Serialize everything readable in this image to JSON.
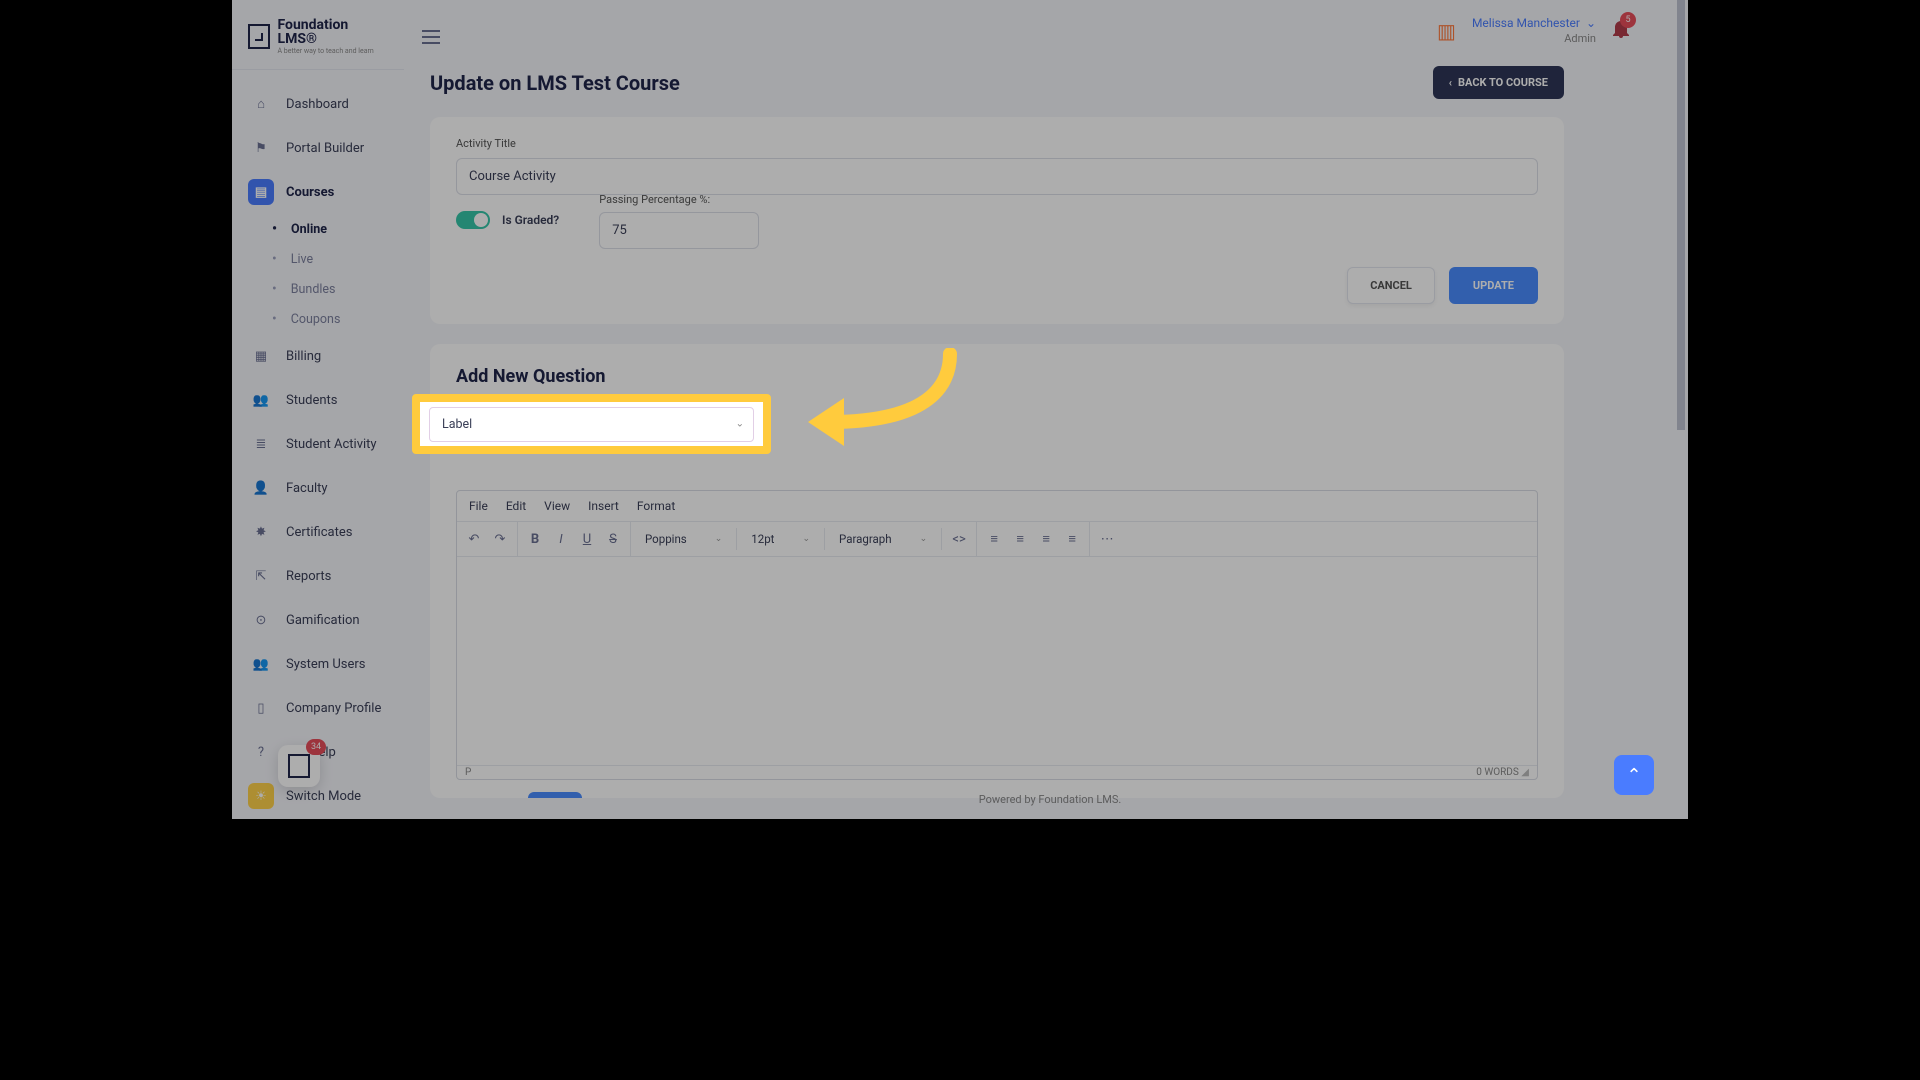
{
  "brand": {
    "title": "Foundation LMS®",
    "tagline": "A better way to teach and learn"
  },
  "user": {
    "name": "Melissa Manchester",
    "role": "Admin",
    "bellCount": "5"
  },
  "nav": {
    "items": [
      {
        "label": "Dashboard",
        "icon": "⌂"
      },
      {
        "label": "Portal Builder",
        "icon": "⚑"
      },
      {
        "label": "Courses",
        "icon": "▤"
      },
      {
        "label": "Billing",
        "icon": "▦"
      },
      {
        "label": "Students",
        "icon": "👥"
      },
      {
        "label": "Student Activity",
        "icon": "≣"
      },
      {
        "label": "Faculty",
        "icon": "👤"
      },
      {
        "label": "Certificates",
        "icon": "✸"
      },
      {
        "label": "Reports",
        "icon": "⇱"
      },
      {
        "label": "Gamification",
        "icon": "⊙"
      },
      {
        "label": "System Users",
        "icon": "👥"
      },
      {
        "label": "Company Profile",
        "icon": "▯"
      },
      {
        "label": "Get Help",
        "icon": "?"
      },
      {
        "label": "Switch Mode",
        "icon": "☀"
      }
    ],
    "sub": [
      {
        "label": "Online"
      },
      {
        "label": "Live"
      },
      {
        "label": "Bundles"
      },
      {
        "label": "Coupons"
      }
    ]
  },
  "page": {
    "title": "Update on LMS Test Course",
    "back": "BACK TO COURSE"
  },
  "form": {
    "activityTitleLabel": "Activity Title",
    "activityTitleValue": "Course Activity",
    "gradedLabel": "Is Graded?",
    "passLabel": "Passing Percentage %:",
    "passValue": "75",
    "cancel": "CANCEL",
    "update": "UPDATE"
  },
  "question": {
    "heading": "Add New Question",
    "typeValue": "Label"
  },
  "editor": {
    "menu": [
      "File",
      "Edit",
      "View",
      "Insert",
      "Format"
    ],
    "font": "Poppins",
    "size": "12pt",
    "para": "Paragraph",
    "path": "P",
    "words": "0 WORDS"
  },
  "footer": "Powered by Foundation LMS.",
  "chat": {
    "count": "34"
  }
}
